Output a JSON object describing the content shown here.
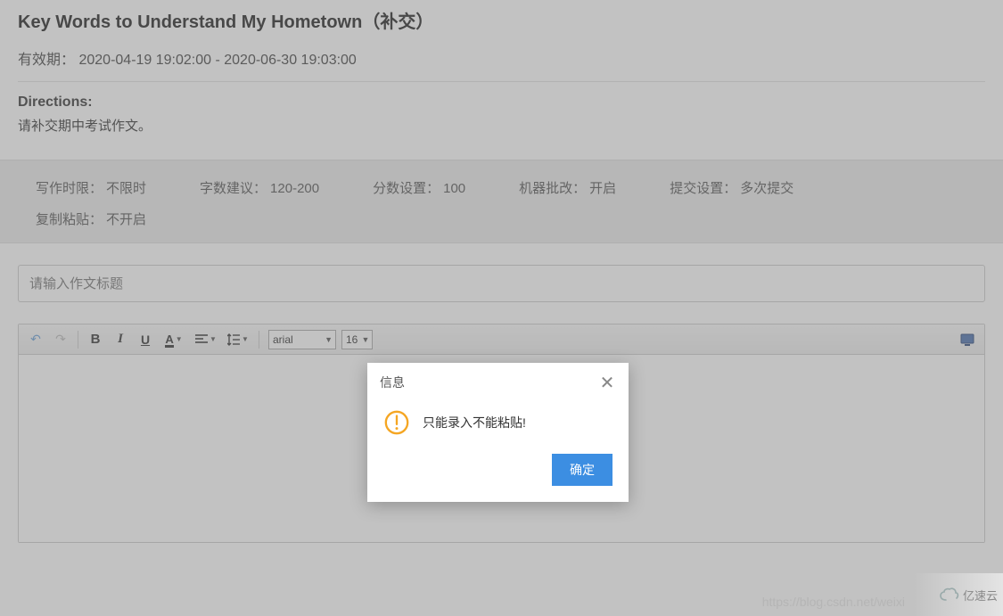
{
  "header": {
    "title": "Key Words to Understand My Hometown（补交）",
    "validity_label": "有效期：",
    "validity_value": "2020-04-19 19:02:00 - 2020-06-30 19:03:00",
    "directions_label": "Directions:",
    "directions_text": "请补交期中考试作文。"
  },
  "meta": {
    "items": [
      {
        "label": "写作时限：",
        "value": "不限时"
      },
      {
        "label": "字数建议：",
        "value": "120-200"
      },
      {
        "label": "分数设置：",
        "value": "100"
      },
      {
        "label": "机器批改：",
        "value": "开启"
      },
      {
        "label": "提交设置：",
        "value": "多次提交"
      },
      {
        "label": "复制粘贴：",
        "value": "不开启"
      }
    ]
  },
  "editor": {
    "title_placeholder": "请输入作文标题",
    "font_family": "arial",
    "font_size": "16"
  },
  "modal": {
    "title": "信息",
    "message": "只能录入不能粘贴!",
    "ok": "确定"
  },
  "watermark": "https://blog.csdn.net/weixi",
  "brand": "亿速云",
  "icons": {
    "undo": "↶",
    "redo": "↷",
    "bold": "B",
    "italic": "I",
    "underline": "U",
    "close": "✕",
    "chevron": "▼"
  },
  "colors": {
    "primary_button": "#3c8ee2",
    "warn_ring": "#f5a623"
  }
}
